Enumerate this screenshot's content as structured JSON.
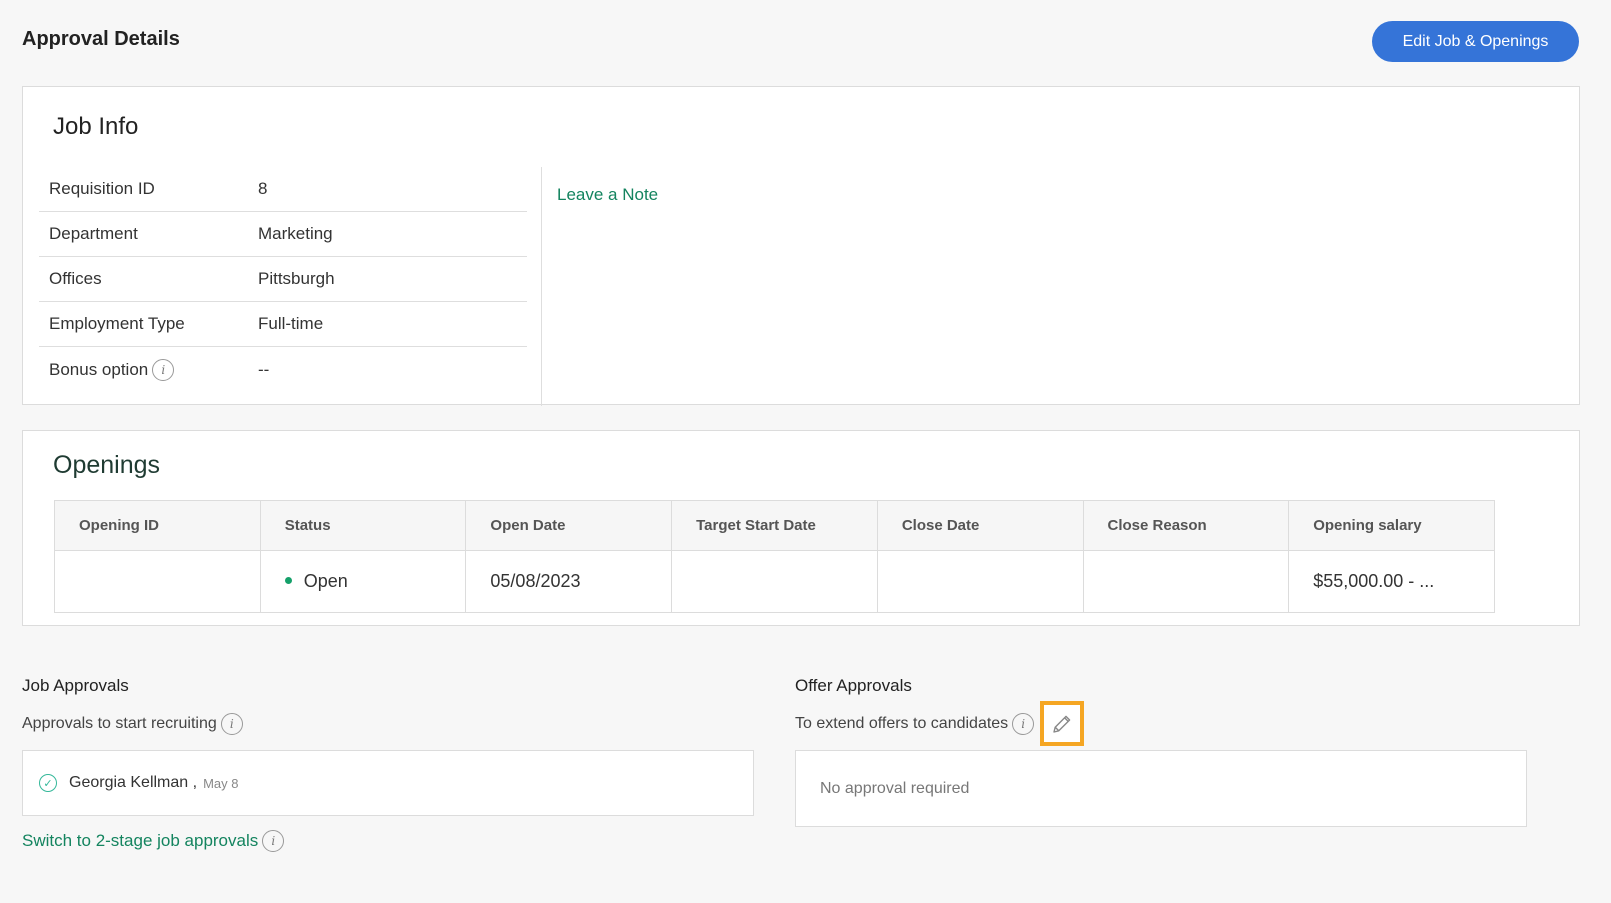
{
  "header": {
    "title": "Approval Details",
    "edit_button": "Edit Job & Openings"
  },
  "job_info": {
    "title": "Job Info",
    "rows": [
      {
        "label": "Requisition ID",
        "value": "8"
      },
      {
        "label": "Department",
        "value": "Marketing"
      },
      {
        "label": "Offices",
        "value": "Pittsburgh"
      },
      {
        "label": "Employment Type",
        "value": "Full-time"
      },
      {
        "label": "Bonus option",
        "value": "--"
      }
    ],
    "leave_note": "Leave a Note"
  },
  "openings": {
    "title": "Openings",
    "columns": [
      "Opening ID",
      "Status",
      "Open Date",
      "Target Start Date",
      "Close Date",
      "Close Reason",
      "Opening salary"
    ],
    "rows": [
      {
        "opening_id": "",
        "status": "Open",
        "open_date": "05/08/2023",
        "target_start_date": "",
        "close_date": "",
        "close_reason": "",
        "salary": "$55,000.00 - ..."
      }
    ]
  },
  "job_approvals": {
    "title": "Job Approvals",
    "subtitle": "Approvals to start recruiting",
    "approver_name": "Georgia Kellman ,",
    "approver_date": "May 8",
    "switch_link": "Switch to 2-stage job approvals"
  },
  "offer_approvals": {
    "title": "Offer Approvals",
    "subtitle": "To extend offers to candidates",
    "empty_text": "No approval required"
  },
  "colors": {
    "primary_button": "#3574d8",
    "link_green": "#14845f",
    "status_open": "#15a06a",
    "highlight": "#f5a623",
    "check": "#35b89a"
  },
  "icons": {
    "info": "info-icon",
    "check": "check-circle-icon",
    "edit": "pencil-icon"
  }
}
